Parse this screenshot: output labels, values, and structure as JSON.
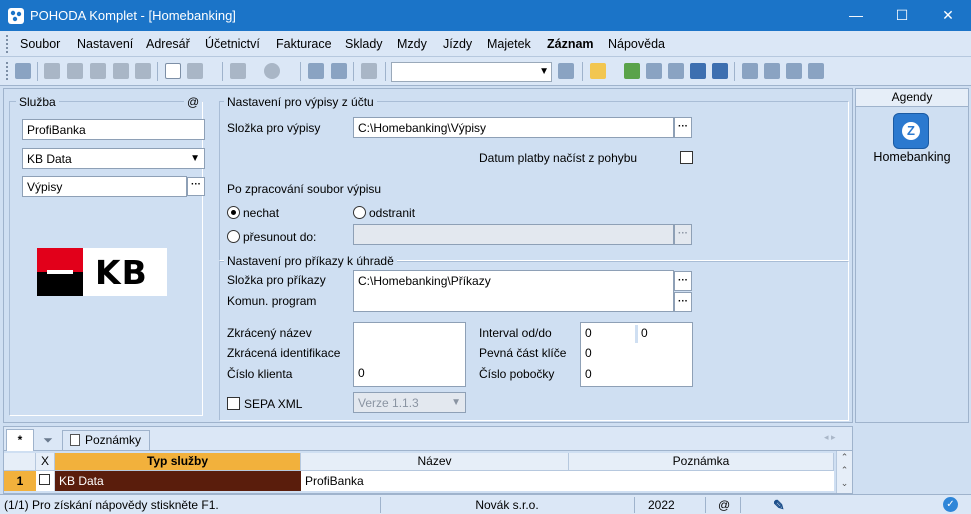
{
  "window": {
    "title": "POHODA Komplet - [Homebanking]",
    "minimize": "—",
    "maximize": "☐",
    "close": "✕"
  },
  "menu": [
    "Soubor",
    "Nastavení",
    "Adresář",
    "Účetnictví",
    "Fakturace",
    "Sklady",
    "Mzdy",
    "Jízdy",
    "Majetek",
    "Záznam",
    "Nápověda"
  ],
  "sluzba": {
    "title": "Služba",
    "at": "@",
    "name": "ProfiBanka",
    "format": "KB Data",
    "type": "Výpisy",
    "logo_text": "KB"
  },
  "vypisy": {
    "title": "Nastavení pro výpisy z účtu",
    "folder_label": "Složka pro výpisy",
    "folder_value": "C:\\Homebanking\\Výpisy",
    "datum_label": "Datum platby načíst z pohybu",
    "after_label": "Po zpracování soubor výpisu",
    "opt_keep": "nechat",
    "opt_delete": "odstranit",
    "opt_move": "přesunout do:"
  },
  "prikazy": {
    "title": "Nastavení pro příkazy k úhradě",
    "folder_label": "Složka pro příkazy",
    "folder_value": "C:\\Homebanking\\Příkazy",
    "komun_label": "Komun. program",
    "short_name_label": "Zkrácený název",
    "short_id_label": "Zkrácená identifikace",
    "client_no_label": "Číslo klienta",
    "client_no_value": "0",
    "interval_label": "Interval od/do",
    "interval_from": "0",
    "interval_to": "0",
    "fixed_key_label": "Pevná část klíče",
    "fixed_key_value": "0",
    "branch_label": "Číslo pobočky",
    "branch_value": "0",
    "sepa_label": "SEPA XML",
    "version": "Verze 1.1.3"
  },
  "agendy": {
    "title": "Agendy",
    "item": "Homebanking"
  },
  "bottom": {
    "tab_star": "*",
    "tab_notes": "Poznámky",
    "col_x": "X",
    "col_type": "Typ služby",
    "col_name": "Název",
    "col_note": "Poznámka",
    "row_no": "1",
    "row_type": "KB Data",
    "row_name": "ProfiBanka",
    "row_note": ""
  },
  "status": {
    "help": "(1/1) Pro získání nápovědy stiskněte F1.",
    "company": "Novák s.r.o.",
    "year": "2022",
    "at": "@"
  },
  "colors": {
    "title": "#1b74c8",
    "bg": "#cfdff2",
    "selected_header": "#f2b13c",
    "selected_row": "#5a1d0c"
  }
}
